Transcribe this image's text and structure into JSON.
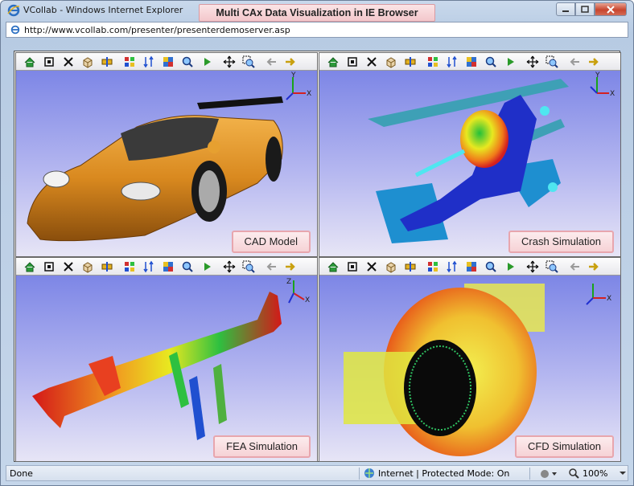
{
  "window": {
    "title": "VCollab - Windows Internet Explorer",
    "banner": "Multi CAx Data Visualization in IE Browser"
  },
  "address": {
    "url": "http://www.vcollab.com/presenter/presenterdemoserver.asp"
  },
  "panes": [
    {
      "label": "CAD Model"
    },
    {
      "label": "Crash Simulation"
    },
    {
      "label": "FEA Simulation"
    },
    {
      "label": "CFD Simulation"
    }
  ],
  "toolbar_icons": [
    "home-icon",
    "fit-view-icon",
    "explode-icon",
    "cube-icon",
    "section-icon",
    "animate-icon",
    "sort-icon",
    "color-map-icon",
    "magnify-icon",
    "play-icon",
    "pan-icon",
    "zoom-box-icon",
    "back-arrow-icon",
    "forward-arrow-icon"
  ],
  "axes": {
    "x": "X",
    "y": "Y",
    "z": "Z"
  },
  "status": {
    "left": "Done",
    "zone": "Internet | Protected Mode: On",
    "zoom": "100%"
  },
  "colors": {
    "viewport_top": "#7d86e6",
    "viewport_bottom": "#e8e6f6",
    "label_border": "#e8a6ae"
  }
}
